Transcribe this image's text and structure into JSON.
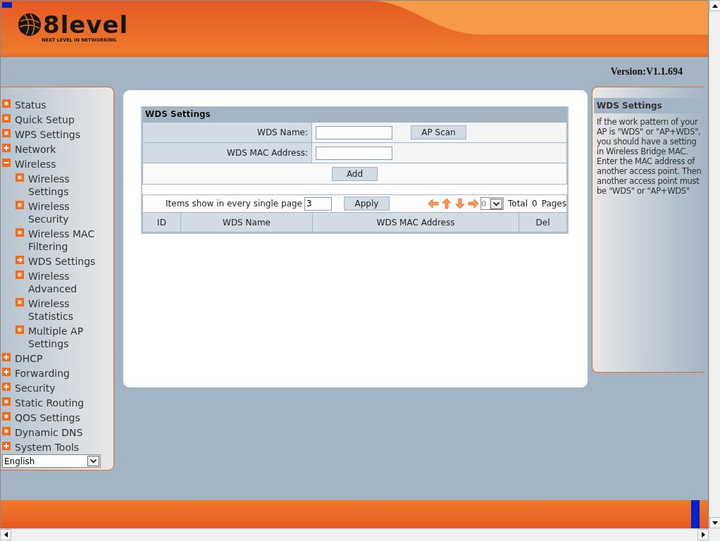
{
  "header": {
    "wordmark": "8level",
    "tagline": "NEXT LEVEL IN NETWORKING"
  },
  "version": "Version:V1.1.694",
  "sidebar": {
    "items": [
      {
        "label": "Status",
        "kind": "page",
        "selected": false
      },
      {
        "label": "Quick Setup",
        "kind": "page",
        "selected": false
      },
      {
        "label": "WPS Settings",
        "kind": "page",
        "selected": false
      },
      {
        "label": "Network",
        "kind": "group",
        "expanded": false
      },
      {
        "label": "Wireless",
        "kind": "group",
        "expanded": true,
        "children": [
          {
            "label": "Wireless Settings",
            "kind": "page",
            "selected": false
          },
          {
            "label": "Wireless Security",
            "kind": "page",
            "selected": false
          },
          {
            "label": "Wireless MAC Filtering",
            "kind": "page",
            "selected": false
          },
          {
            "label": "WDS Settings",
            "kind": "page",
            "selected": true
          },
          {
            "label": "Wireless Advanced",
            "kind": "page",
            "selected": false
          },
          {
            "label": "Wireless Statistics",
            "kind": "page",
            "selected": false
          },
          {
            "label": "Multiple AP Settings",
            "kind": "page",
            "selected": false
          }
        ]
      },
      {
        "label": "DHCP",
        "kind": "group",
        "expanded": false
      },
      {
        "label": "Forwarding",
        "kind": "group",
        "expanded": false
      },
      {
        "label": "Security",
        "kind": "group",
        "expanded": false
      },
      {
        "label": "Static Routing",
        "kind": "page",
        "selected": false
      },
      {
        "label": "QOS Settings",
        "kind": "page",
        "selected": false
      },
      {
        "label": "Dynamic DNS",
        "kind": "page",
        "selected": false
      },
      {
        "label": "System Tools",
        "kind": "group",
        "expanded": false
      }
    ],
    "language": "English"
  },
  "form": {
    "title": "WDS Settings",
    "fields": [
      {
        "label": "WDS Name:",
        "button": "AP Scan"
      },
      {
        "label": "WDS MAC Address:"
      }
    ],
    "add_button": "Add"
  },
  "pager": {
    "label": "Items show in every single page",
    "per_page": "3",
    "apply_button": "Apply",
    "page": "0",
    "total_label": "Total",
    "total": "0",
    "pages_label": "Pages"
  },
  "table": {
    "columns": [
      "ID",
      "WDS Name",
      "WDS MAC Address",
      "Del"
    ]
  },
  "help": {
    "title": "WDS Settings",
    "text": "If the work pattern of your AP is \"WDS\" or \"AP+WDS\", you should have a setting in Wireless Bridge MAC. Enter the MAC address of another access point. Then another access point must be \"WDS\" or \"AP+WDS\""
  }
}
